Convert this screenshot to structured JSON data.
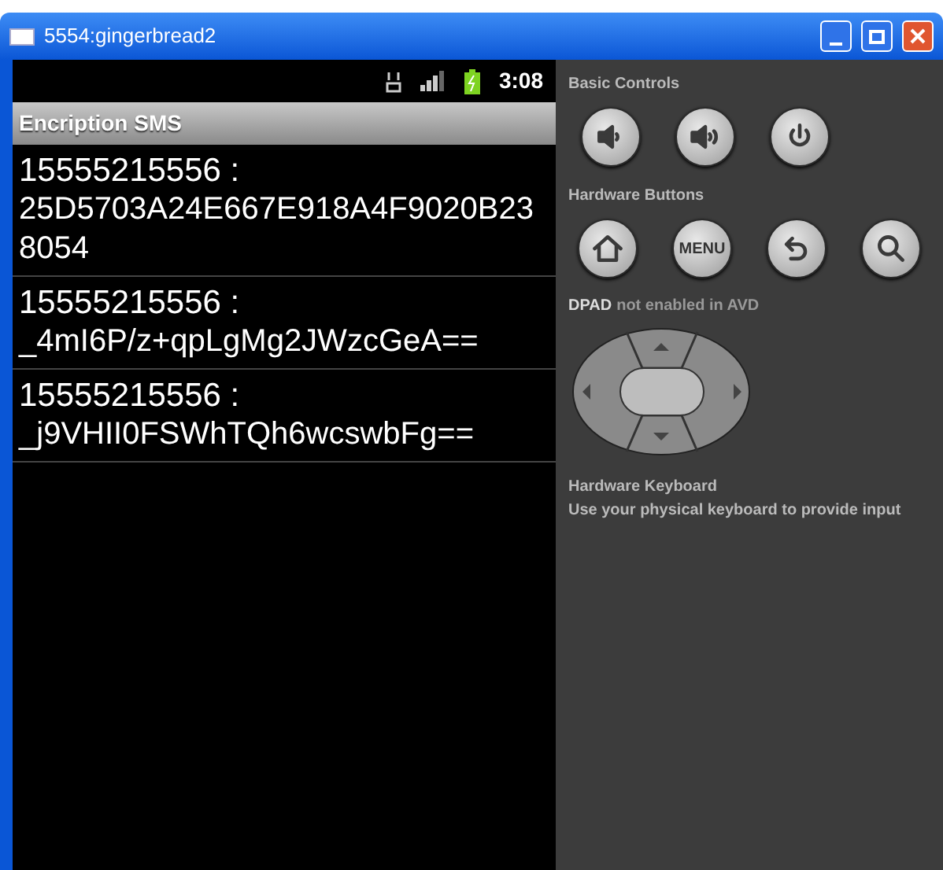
{
  "window": {
    "title": "5554:gingerbread2"
  },
  "status_bar": {
    "time": "3:08"
  },
  "app": {
    "title": "Encription SMS"
  },
  "messages": [
    {
      "sender": "15555215556 :",
      "body": "25D5703A24E667E918A4F9020B238054"
    },
    {
      "sender": "15555215556 :",
      "body": "_4mI6P/z+qpLgMg2JWzcGeA=="
    },
    {
      "sender": "15555215556 :",
      "body": "_j9VHII0FSWhTQh6wcswbFg=="
    }
  ],
  "controls": {
    "basic_title": "Basic Controls",
    "basic": [
      {
        "kind": "volume-down"
      },
      {
        "kind": "volume-up"
      },
      {
        "kind": "power"
      }
    ],
    "hardware_title": "Hardware Buttons",
    "hardware": [
      {
        "kind": "home"
      },
      {
        "kind": "menu",
        "label": "MENU"
      },
      {
        "kind": "back"
      },
      {
        "kind": "search"
      }
    ],
    "dpad_label": "DPAD",
    "dpad_note": "not enabled in AVD",
    "keyboard_title": "Hardware Keyboard",
    "keyboard_note": "Use your physical keyboard to provide input"
  }
}
